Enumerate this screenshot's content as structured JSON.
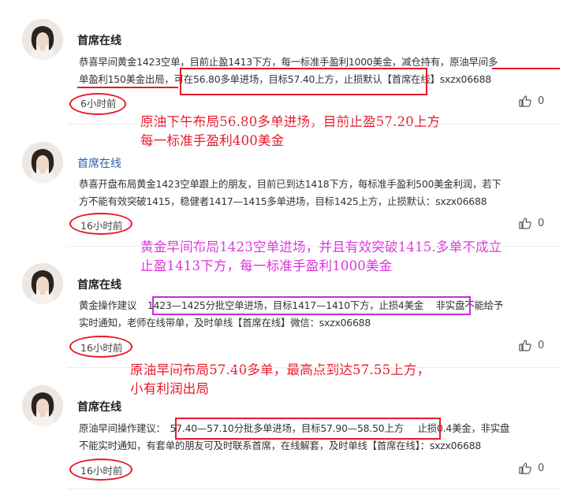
{
  "posts": [
    {
      "author": "首席在线",
      "text_line1": "恭喜早间黄金1423空单，目前止盈1413下方，每一标准手盈利1000美金，减仓持有，原油早间多",
      "text_line2": "单盈利150美金出局，可在56.80多单进场，目标57.40上方，止损默认【首席在线】sxzx06688",
      "time": "6小时前",
      "likes": "0",
      "annotation": [
        "原油下午布局56.80多单进场，目前止盈57.20上方",
        "每一标准手盈利400美金"
      ]
    },
    {
      "author": "首席在线",
      "text_line1": "恭喜开盘布局黄金1423空单跟上的朋友，目前已到达1418下方，每标准手盈利500美金利润，若下",
      "text_line2": "方不能有效突破1415，稳健者1417—1415多单进场，目标1425上方，止损默认：sxzx06688",
      "time": "16小时前",
      "likes": "0",
      "annotation": [
        "黄金早间布局1423空单进场，并且有效突破1415.多单不成立",
        "止盈1413下方，每一标准手盈利1000美金"
      ]
    },
    {
      "author": "首席在线",
      "text_line1_prefix": "黄金操作建议",
      "text_line1_boxed": "1423—1425分批空单进场，目标1417—1410下方，止损4美金",
      "text_line1_suffix": "非实盘不能给予",
      "text_line2": "实时通知，老师在线带单，及时单线【首席在线】微信：sxzx06688",
      "time": "16小时前",
      "likes": "0",
      "annotation": [
        "原油早间布局57.40多单，最高点到达57.55上方，",
        "小有利润出局"
      ]
    },
    {
      "author": "首席在线",
      "text_line1_prefix": "原油早间操作建议：",
      "text_line1_boxed": "57.40—57.10分批多单进场，目标57.90—58.50上方",
      "text_line1_suffix": "止损0.4美金，非实盘",
      "text_line2": "不能实时通知，有套单的朋友可及时联系首席，在线解套，及时单线【首席在线】：sxzx06688",
      "time": "16小时前",
      "likes": "0"
    }
  ],
  "colors": {
    "annotation_red": "#e8182a",
    "annotation_magenta": "#e030e0",
    "author_blue": "#2e5fb0"
  },
  "icons": {
    "like": "thumbs-up-icon",
    "avatar": "avatar"
  }
}
